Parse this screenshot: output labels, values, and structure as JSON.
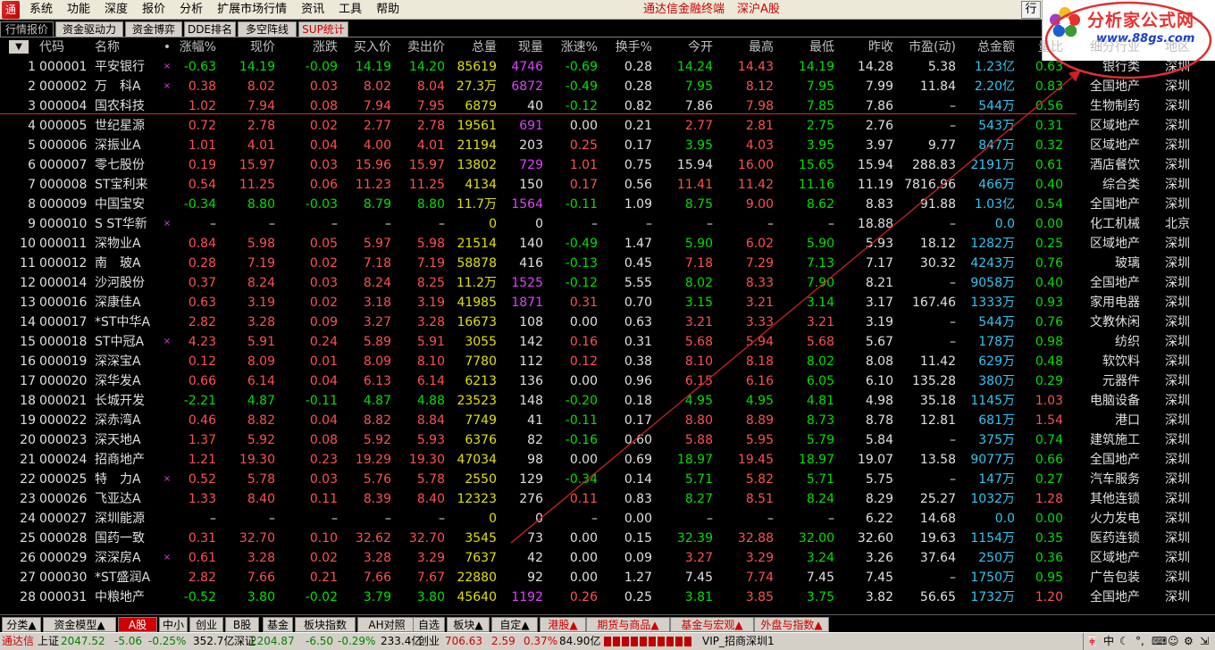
{
  "menu": {
    "items": [
      "系统",
      "功能",
      "深度",
      "报价",
      "分析",
      "扩展市场行情",
      "资讯",
      "工具",
      "帮助"
    ],
    "center_title": "通达信金融终端",
    "center_sub": "深沪A股",
    "right_button": "行"
  },
  "logo": {
    "title": "分析家公式网",
    "url": "www.88gs.com"
  },
  "tabs": [
    "行情报价",
    "资金驱动力",
    "资金博弈",
    "DDE排名",
    "多空阵线",
    "SUP统计"
  ],
  "table": {
    "headers": [
      "代码",
      "名称",
      "•",
      "涨幅%",
      "现价",
      "涨跌",
      "买入价",
      "卖出价",
      "总量",
      "现量",
      "涨速%",
      "换手%",
      "今开",
      "最高",
      "最低",
      "昨收",
      "市盈(动)",
      "总金额",
      "量比",
      "细分行业",
      "地区"
    ],
    "rows": [
      [
        "1",
        "000001",
        "平安银行",
        "×",
        "-0.63",
        "14.19",
        "-0.09",
        "14.19",
        "14.20",
        "85619",
        "4746",
        "-0.69",
        "0.28",
        "14.24",
        "14.43",
        "14.19",
        "14.28",
        "5.38",
        "1.23亿",
        "0.63",
        "银行类",
        "深圳"
      ],
      [
        "2",
        "000002",
        "万　科A",
        "×",
        "0.38",
        "8.02",
        "0.03",
        "8.02",
        "8.04",
        "27.3万",
        "6872",
        "-0.49",
        "0.28",
        "7.95",
        "8.12",
        "7.95",
        "7.99",
        "11.84",
        "2.20亿",
        "0.83",
        "全国地产",
        "深圳"
      ],
      [
        "3",
        "000004",
        "国农科技",
        "",
        "1.02",
        "7.94",
        "0.08",
        "7.94",
        "7.95",
        "6879",
        "40",
        "-0.12",
        "0.82",
        "7.86",
        "7.98",
        "7.85",
        "7.86",
        "–",
        "544万",
        "0.56",
        "生物制药",
        "深圳"
      ],
      [
        "4",
        "000005",
        "世纪星源",
        "",
        "0.72",
        "2.78",
        "0.02",
        "2.77",
        "2.78",
        "19561",
        "691",
        "0.00",
        "0.21",
        "2.77",
        "2.81",
        "2.75",
        "2.76",
        "–",
        "543万",
        "0.31",
        "区域地产",
        "深圳"
      ],
      [
        "5",
        "000006",
        "深振业A",
        "",
        "1.01",
        "4.01",
        "0.04",
        "4.00",
        "4.01",
        "21194",
        "203",
        "0.25",
        "0.17",
        "3.95",
        "4.03",
        "3.95",
        "3.97",
        "9.77",
        "847万",
        "0.32",
        "区域地产",
        "深圳"
      ],
      [
        "6",
        "000007",
        "零七股份",
        "",
        "0.19",
        "15.97",
        "0.03",
        "15.96",
        "15.97",
        "13802",
        "729",
        "1.01",
        "0.75",
        "15.94",
        "16.00",
        "15.65",
        "15.94",
        "288.83",
        "2191万",
        "0.61",
        "酒店餐饮",
        "深圳"
      ],
      [
        "7",
        "000008",
        "ST宝利来",
        "",
        "0.54",
        "11.25",
        "0.06",
        "11.23",
        "11.25",
        "4134",
        "150",
        "0.17",
        "0.56",
        "11.41",
        "11.42",
        "11.16",
        "11.19",
        "7816.96",
        "466万",
        "0.40",
        "综合类",
        "深圳"
      ],
      [
        "8",
        "000009",
        "中国宝安",
        "",
        "-0.34",
        "8.80",
        "-0.03",
        "8.79",
        "8.80",
        "11.7万",
        "1564",
        "-0.11",
        "1.09",
        "8.75",
        "9.00",
        "8.62",
        "8.83",
        "91.88",
        "1.03亿",
        "0.54",
        "全国地产",
        "深圳"
      ],
      [
        "9",
        "000010",
        "S ST华新",
        "×",
        "–",
        "–",
        "–",
        "–",
        "–",
        "0",
        "0",
        "–",
        "–",
        "–",
        "–",
        "–",
        "18.88",
        "–",
        "0.0",
        "0.00",
        "化工机械",
        "北京"
      ],
      [
        "10",
        "000011",
        "深物业A",
        "",
        "0.84",
        "5.98",
        "0.05",
        "5.97",
        "5.98",
        "21514",
        "140",
        "-0.49",
        "1.47",
        "5.90",
        "6.02",
        "5.90",
        "5.93",
        "18.12",
        "1282万",
        "0.25",
        "区域地产",
        "深圳"
      ],
      [
        "11",
        "000012",
        "南　玻A",
        "",
        "0.28",
        "7.19",
        "0.02",
        "7.18",
        "7.19",
        "58878",
        "416",
        "-0.13",
        "0.45",
        "7.18",
        "7.29",
        "7.13",
        "7.17",
        "30.32",
        "4243万",
        "0.76",
        "玻璃",
        "深圳"
      ],
      [
        "12",
        "000014",
        "沙河股份",
        "",
        "0.37",
        "8.24",
        "0.03",
        "8.24",
        "8.25",
        "11.2万",
        "1525",
        "-0.12",
        "5.55",
        "8.02",
        "8.33",
        "7.90",
        "8.21",
        "–",
        "9058万",
        "0.40",
        "全国地产",
        "深圳"
      ],
      [
        "13",
        "000016",
        "深康佳A",
        "",
        "0.63",
        "3.19",
        "0.02",
        "3.18",
        "3.19",
        "41985",
        "1871",
        "0.31",
        "0.70",
        "3.15",
        "3.21",
        "3.14",
        "3.17",
        "167.46",
        "1333万",
        "0.93",
        "家用电器",
        "深圳"
      ],
      [
        "14",
        "000017",
        "*ST中华A",
        "",
        "2.82",
        "3.28",
        "0.09",
        "3.27",
        "3.28",
        "16673",
        "108",
        "0.00",
        "0.63",
        "3.21",
        "3.33",
        "3.21",
        "3.19",
        "–",
        "544万",
        "0.76",
        "文教休闲",
        "深圳"
      ],
      [
        "15",
        "000018",
        "ST中冠A",
        "×",
        "4.23",
        "5.91",
        "0.24",
        "5.89",
        "5.91",
        "3055",
        "142",
        "0.16",
        "0.31",
        "5.68",
        "5.94",
        "5.68",
        "5.67",
        "–",
        "178万",
        "0.98",
        "纺织",
        "深圳"
      ],
      [
        "16",
        "000019",
        "深深宝A",
        "",
        "0.12",
        "8.09",
        "0.01",
        "8.09",
        "8.10",
        "7780",
        "112",
        "0.12",
        "0.38",
        "8.10",
        "8.18",
        "8.02",
        "8.08",
        "11.42",
        "629万",
        "0.48",
        "软饮料",
        "深圳"
      ],
      [
        "17",
        "000020",
        "深华发A",
        "",
        "0.66",
        "6.14",
        "0.04",
        "6.13",
        "6.14",
        "6213",
        "136",
        "0.00",
        "0.96",
        "6.15",
        "6.16",
        "6.05",
        "6.10",
        "135.28",
        "380万",
        "0.29",
        "元器件",
        "深圳"
      ],
      [
        "18",
        "000021",
        "长城开发",
        "",
        "-2.21",
        "4.87",
        "-0.11",
        "4.87",
        "4.88",
        "23523",
        "148",
        "-0.20",
        "0.18",
        "4.95",
        "4.95",
        "4.81",
        "4.98",
        "35.18",
        "1145万",
        "1.03",
        "电脑设备",
        "深圳"
      ],
      [
        "19",
        "000022",
        "深赤湾A",
        "",
        "0.46",
        "8.82",
        "0.04",
        "8.82",
        "8.84",
        "7749",
        "41",
        "-0.11",
        "0.17",
        "8.80",
        "8.89",
        "8.73",
        "8.78",
        "12.81",
        "681万",
        "1.54",
        "港口",
        "深圳"
      ],
      [
        "20",
        "000023",
        "深天地A",
        "",
        "1.37",
        "5.92",
        "0.08",
        "5.92",
        "5.93",
        "6376",
        "82",
        "-0.16",
        "0.60",
        "5.88",
        "5.95",
        "5.79",
        "5.84",
        "–",
        "375万",
        "0.74",
        "建筑施工",
        "深圳"
      ],
      [
        "21",
        "000024",
        "招商地产",
        "",
        "1.21",
        "19.30",
        "0.23",
        "19.29",
        "19.30",
        "47034",
        "98",
        "0.00",
        "0.69",
        "18.97",
        "19.45",
        "18.97",
        "19.07",
        "13.58",
        "9077万",
        "0.66",
        "全国地产",
        "深圳"
      ],
      [
        "22",
        "000025",
        "特　力A",
        "×",
        "0.52",
        "5.78",
        "0.03",
        "5.76",
        "5.78",
        "2550",
        "129",
        "-0.34",
        "0.14",
        "5.71",
        "5.82",
        "5.71",
        "5.75",
        "–",
        "147万",
        "0.27",
        "汽车服务",
        "深圳"
      ],
      [
        "23",
        "000026",
        "飞亚达A",
        "",
        "1.33",
        "8.40",
        "0.11",
        "8.39",
        "8.40",
        "12323",
        "276",
        "0.11",
        "0.83",
        "8.27",
        "8.51",
        "8.24",
        "8.29",
        "25.27",
        "1032万",
        "1.28",
        "其他连锁",
        "深圳"
      ],
      [
        "24",
        "000027",
        "深圳能源",
        "",
        "–",
        "–",
        "–",
        "–",
        "–",
        "0",
        "0",
        "–",
        "0.00",
        "–",
        "–",
        "–",
        "6.22",
        "14.68",
        "0.0",
        "0.00",
        "火力发电",
        "深圳"
      ],
      [
        "25",
        "000028",
        "国药一致",
        "",
        "0.31",
        "32.70",
        "0.10",
        "32.62",
        "32.70",
        "3545",
        "73",
        "0.00",
        "0.15",
        "32.39",
        "32.88",
        "32.00",
        "32.60",
        "19.63",
        "1154万",
        "0.35",
        "医药连锁",
        "深圳"
      ],
      [
        "26",
        "000029",
        "深深房A",
        "×",
        "0.61",
        "3.28",
        "0.02",
        "3.28",
        "3.29",
        "7637",
        "42",
        "0.00",
        "0.09",
        "3.27",
        "3.29",
        "3.24",
        "3.26",
        "37.64",
        "250万",
        "0.36",
        "区域地产",
        "深圳"
      ],
      [
        "27",
        "000030",
        "*ST盛润A",
        "",
        "2.82",
        "7.66",
        "0.21",
        "7.66",
        "7.67",
        "22880",
        "92",
        "0.00",
        "1.27",
        "7.45",
        "7.74",
        "7.45",
        "7.45",
        "–",
        "1750万",
        "0.95",
        "广告包装",
        "深圳"
      ],
      [
        "28",
        "000031",
        "中粮地产",
        "",
        "-0.52",
        "3.80",
        "-0.02",
        "3.79",
        "3.80",
        "45640",
        "1192",
        "0.26",
        "0.25",
        "3.81",
        "3.85",
        "3.75",
        "3.82",
        "56.65",
        "1732万",
        "1.20",
        "全国地产",
        "深圳"
      ]
    ]
  },
  "bottom_tabs": [
    "分类▲",
    "资金模型▲",
    "A股",
    "中小",
    "创业",
    "B股",
    "基金",
    "板块指数",
    "AH对照",
    "自选",
    "板块▲",
    "自定▲",
    "港股▲",
    "期货与商品▲",
    "基金与宏观▲",
    "外盘与指数▲"
  ],
  "status": {
    "brand": "通达信",
    "sh_label": "上证",
    "sh_value": "2047.52",
    "sh_change": "-5.06",
    "sh_pct": "-0.25%",
    "sh_amount": "352.7亿",
    "sz_label": "深证",
    "sz_value": "2204.87",
    "sz_change": "-6.50",
    "sz_pct": "-0.29%",
    "sz_amount": "233.4亿",
    "cy_label": "创业",
    "cy_value": "706.63",
    "cy_change": "2.59",
    "cy_pct": "0.37%",
    "cy_amount": "84.90亿",
    "server": "VIP_招商深圳1"
  },
  "colors": {
    "up": "#ff5050",
    "down": "#00e000",
    "accent": "#d00000",
    "cyan": "#33c6f3"
  }
}
